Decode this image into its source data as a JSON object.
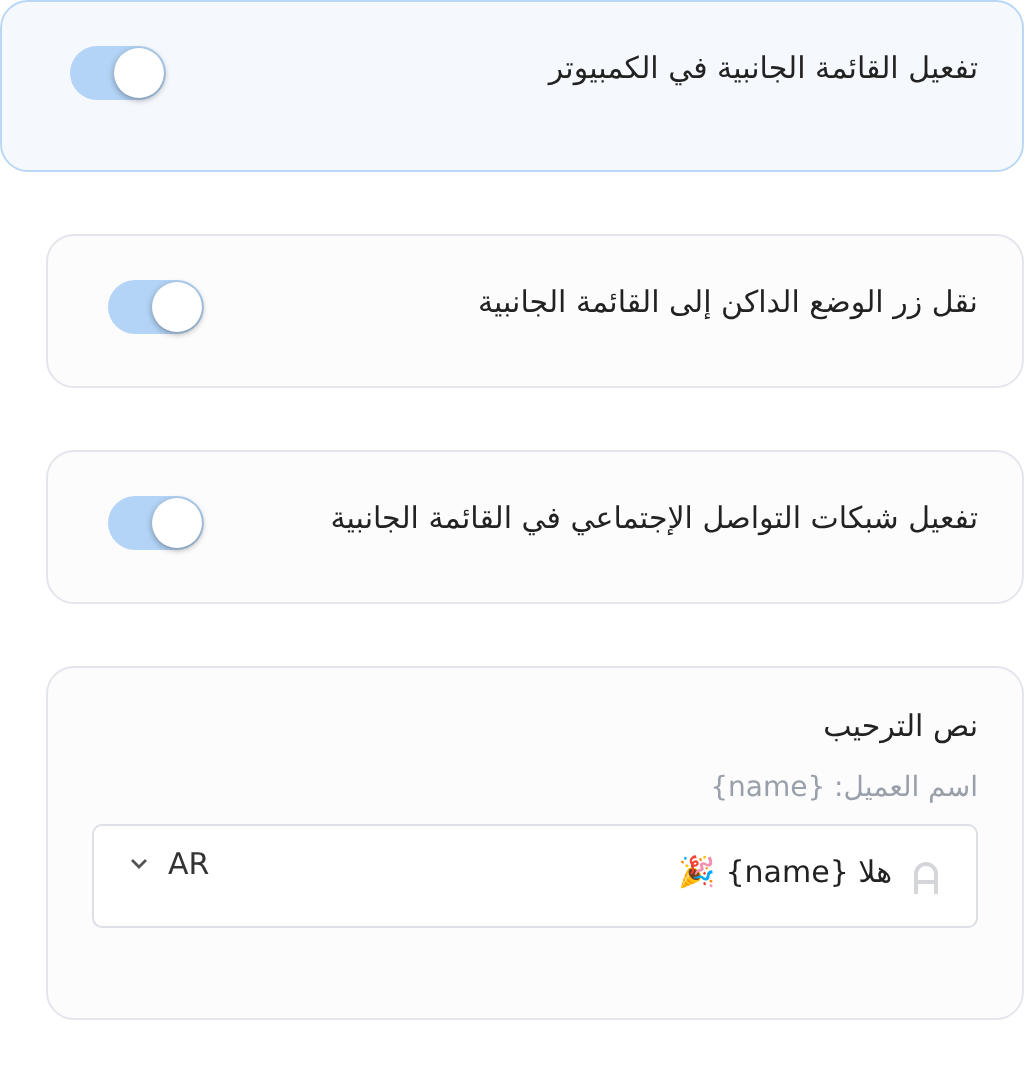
{
  "settings": [
    {
      "label": "تفعيل القائمة الجانبية في الكمبيوتر",
      "on": true,
      "highlighted": true
    },
    {
      "label": "نقل زر الوضع الداكن إلى القائمة الجانبية",
      "on": true,
      "highlighted": false
    },
    {
      "label": "تفعيل شبكات التواصل الإجتماعي في القائمة الجانبية",
      "on": true,
      "highlighted": false
    }
  ],
  "welcome": {
    "title": "نص الترحيب",
    "hint": "اسم العميل: {name}",
    "value": "هلا {name} 🎉",
    "language": "AR"
  }
}
